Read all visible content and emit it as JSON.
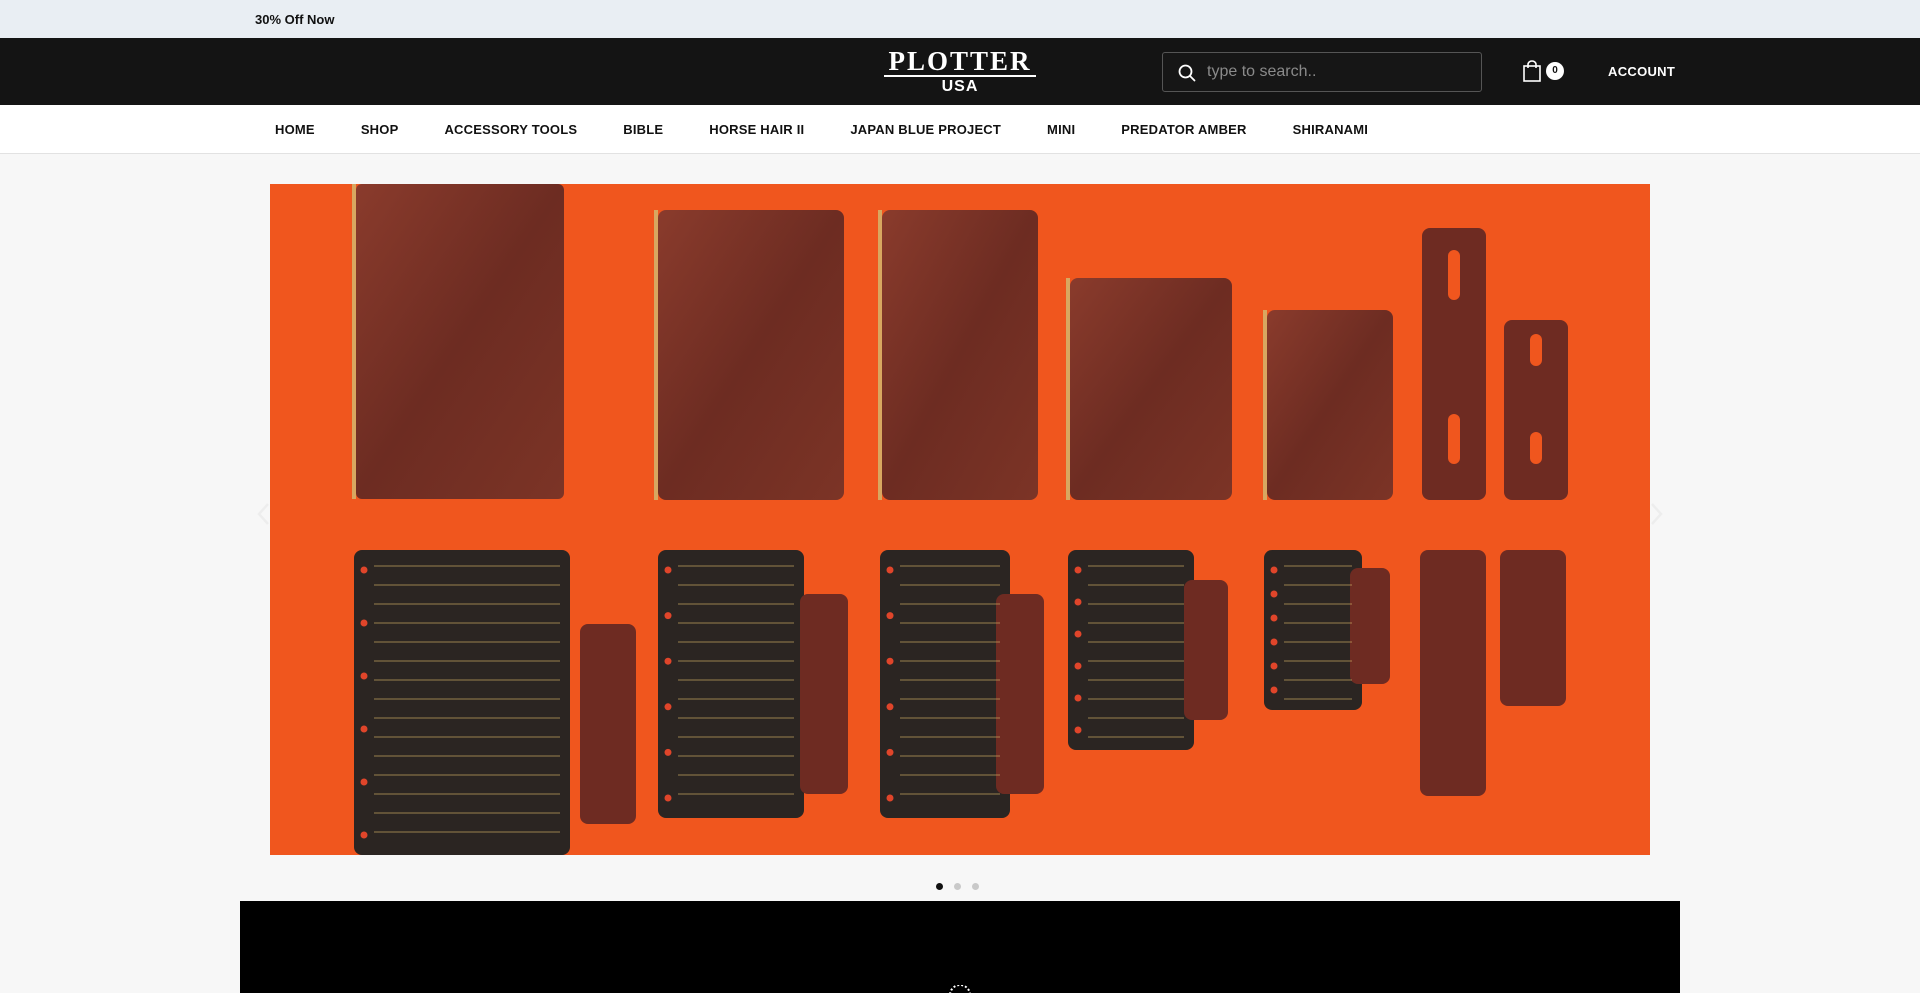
{
  "announcement": {
    "text": "30% Off Now"
  },
  "header": {
    "logo": {
      "top": "PLOTTER",
      "bottom": "USA"
    },
    "search": {
      "placeholder": "type to search..",
      "value": ""
    },
    "cart": {
      "count": "0"
    },
    "account_label": "ACCOUNT"
  },
  "nav": {
    "items": [
      {
        "label": "HOME"
      },
      {
        "label": "SHOP"
      },
      {
        "label": "ACCESSORY TOOLS"
      },
      {
        "label": "BIBLE"
      },
      {
        "label": "HORSE HAIR II"
      },
      {
        "label": "JAPAN BLUE PROJECT"
      },
      {
        "label": "MINI"
      },
      {
        "label": "PREDATOR AMBER"
      },
      {
        "label": "SHIRANAMI"
      }
    ]
  },
  "hero": {
    "background_color": "#f0561e",
    "leather_color": "#7a3327",
    "card_color": "#2b2522",
    "lettering_color": "#c9a960",
    "slide_count": 3,
    "active_slide": 1
  },
  "icons": {
    "search": "search-icon",
    "cart": "shopping-bag-icon",
    "prev": "chevron-left-icon",
    "next": "chevron-right-icon"
  }
}
